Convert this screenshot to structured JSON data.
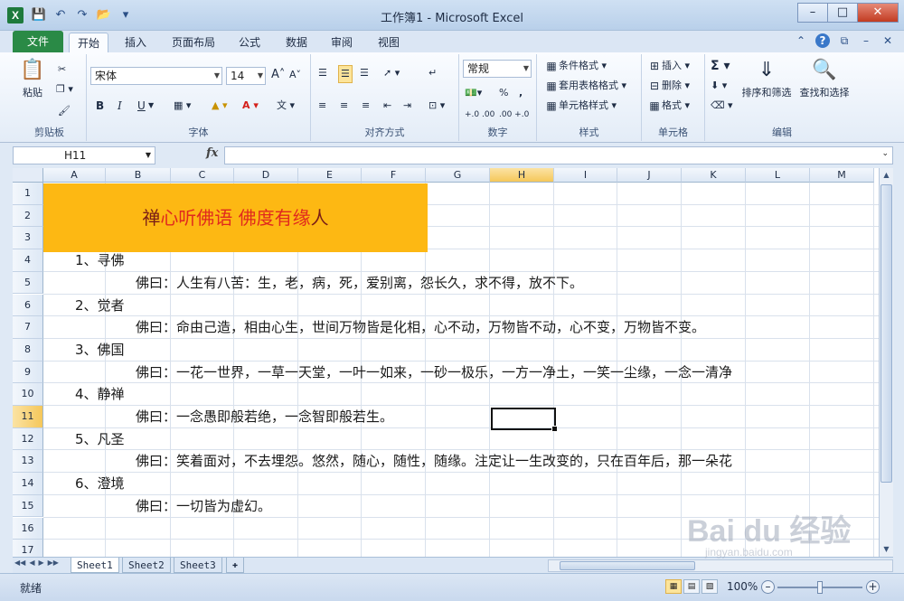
{
  "window": {
    "title": "工作簿1 - Microsoft Excel",
    "app_icon_letter": "X"
  },
  "ribbon_tabs": [
    "文件",
    "开始",
    "插入",
    "页面布局",
    "公式",
    "数据",
    "审阅",
    "视图"
  ],
  "ribbon": {
    "clipboard": {
      "paste": "粘贴",
      "label": "剪贴板"
    },
    "font": {
      "name": "宋体",
      "size": "14",
      "label": "字体",
      "bold": "B",
      "italic": "I",
      "underline": "U"
    },
    "alignment": {
      "label": "对齐方式"
    },
    "number": {
      "format": "常规",
      "label": "数字",
      "percent": "%",
      "comma": ",",
      "inc_decimal": "+.0 .00",
      "dec_decimal": ".00 +.0"
    },
    "styles": {
      "conditional": "条件格式",
      "table": "套用表格格式",
      "cell_styles": "单元格样式",
      "label": "样式"
    },
    "cells": {
      "insert": "插入",
      "delete": "删除",
      "format": "格式",
      "label": "单元格"
    },
    "editing": {
      "sort_filter": "排序和筛选",
      "find_select": "查找和选择",
      "label": "编辑"
    }
  },
  "formula_bar": {
    "name_box": "H11",
    "fx": "fx",
    "content": ""
  },
  "columns": [
    "A",
    "B",
    "C",
    "D",
    "E",
    "F",
    "G",
    "H",
    "I",
    "J",
    "K",
    "L",
    "M"
  ],
  "rows": [
    "1",
    "2",
    "3",
    "4",
    "5",
    "6",
    "7",
    "8",
    "9",
    "10",
    "11",
    "12",
    "13",
    "14",
    "15",
    "16",
    "17"
  ],
  "active_cell": {
    "col": "H",
    "row": "11"
  },
  "title_banner": {
    "part1": "禅",
    "part2": "心听佛语 佛度有缘",
    "part3": "人",
    "fill_color": "#FDB813",
    "dark_color": "#7A1E16",
    "red_color": "#E0291E"
  },
  "cells": [
    {
      "row": "4",
      "text": "1、寻佛",
      "indent": false
    },
    {
      "row": "5",
      "text": "佛曰：人生有八苦：生，老，病，死，爱别离，怨长久，求不得，放不下。",
      "indent": true
    },
    {
      "row": "6",
      "text": "2、觉者",
      "indent": false
    },
    {
      "row": "7",
      "text": "佛曰：命由己造，相由心生，世间万物皆是化相，心不动，万物皆不动，心不变，万物皆不变。",
      "indent": true
    },
    {
      "row": "8",
      "text": "3、佛国",
      "indent": false
    },
    {
      "row": "9",
      "text": "佛曰：一花一世界，一草一天堂，一叶一如来，一砂一极乐，一方一净土，一笑一尘缘，一念一清净",
      "indent": true
    },
    {
      "row": "10",
      "text": "4、静禅",
      "indent": false
    },
    {
      "row": "11",
      "text": "佛曰：一念愚即般若绝，一念智即般若生。",
      "indent": true
    },
    {
      "row": "12",
      "text": "5、凡圣",
      "indent": false
    },
    {
      "row": "13",
      "text": "佛曰：笑着面对，不去埋怨。悠然，随心，随性，随缘。注定让一生改变的，只在百年后，那一朵花",
      "indent": true
    },
    {
      "row": "14",
      "text": "6、澄境",
      "indent": false
    },
    {
      "row": "15",
      "text": "佛曰：一切皆为虚幻。",
      "indent": true
    }
  ],
  "sheets": [
    "Sheet1",
    "Sheet2",
    "Sheet3"
  ],
  "active_sheet": "Sheet1",
  "status": {
    "ready": "就绪",
    "zoom": "100%"
  },
  "watermark": {
    "brand": "Bai du 经验",
    "url": "jingyan.baidu.com"
  }
}
